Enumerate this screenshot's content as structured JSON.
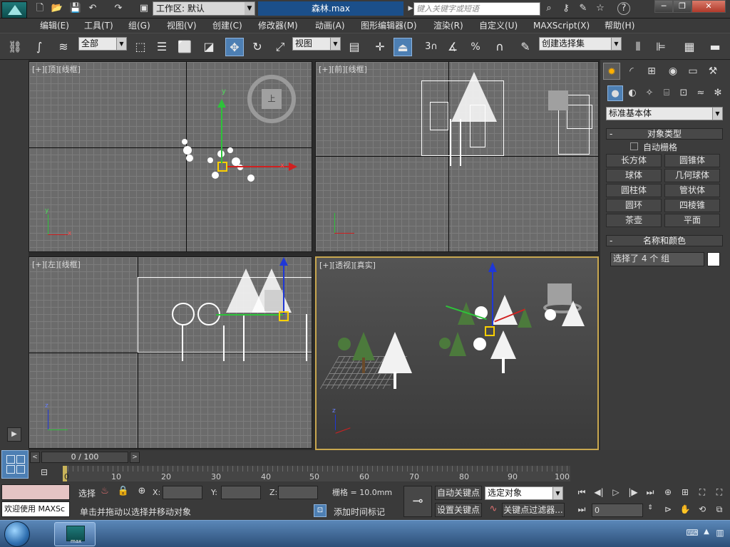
{
  "titlebar": {
    "workspace_label": "工作区: 默认",
    "document_title": "森林.max",
    "search_placeholder": "键入关键字或短语",
    "help_label": "?"
  },
  "menu": [
    "编辑(E)",
    "工具(T)",
    "组(G)",
    "视图(V)",
    "创建(C)",
    "修改器(M)",
    "动画(A)",
    "图形编辑器(D)",
    "渲染(R)",
    "自定义(U)",
    "MAXScript(X)",
    "帮助(H)"
  ],
  "toolbar": {
    "filter_select": "全部",
    "ref_coord_select": "视图",
    "named_selection_set": "创建选择集",
    "snap_label": "3",
    "percent_label": "%"
  },
  "viewports": {
    "top": "[+][顶][线框]",
    "front": "[+][前][线框]",
    "left": "[+][左][线框]",
    "perspective": "[+][透视][真实]",
    "viewcube_top": "上",
    "axis_x": "x",
    "axis_y": "y",
    "axis_z": "z"
  },
  "command_panel": {
    "category_select": "标准基本体",
    "object_type_title": "对象类型",
    "autogrid_label": "自动栅格",
    "object_buttons": [
      "长方体",
      "圆锥体",
      "球体",
      "几何球体",
      "圆柱体",
      "管状体",
      "圆环",
      "四棱锥",
      "茶壶",
      "平面"
    ],
    "name_color_title": "名称和颜色",
    "name_field_value": "选择了 4 个 组",
    "object_color": "#ffffff"
  },
  "timeline": {
    "slider_label": "0 / 100",
    "ticks": [
      "10",
      "20",
      "30",
      "40",
      "50",
      "60",
      "70",
      "80",
      "90",
      "100"
    ],
    "start_tick": "0"
  },
  "status": {
    "maxscript_listener_top": "",
    "maxscript_listener_text": "欢迎使用 MAXSc",
    "select_label": "选择",
    "x_label": "X:",
    "y_label": "Y:",
    "z_label": "Z:",
    "grid_label": "栅格 = 10.0mm",
    "prompt_text": "单击并拖动以选择并移动对象",
    "add_time_tag": "添加时间标记",
    "auto_key": "自动关键点",
    "set_key": "设置关键点",
    "key_mode_select": "选定对象",
    "key_filters": "关键点过滤器...",
    "current_frame": "0"
  },
  "taskbar": {
    "app_label": "max"
  }
}
